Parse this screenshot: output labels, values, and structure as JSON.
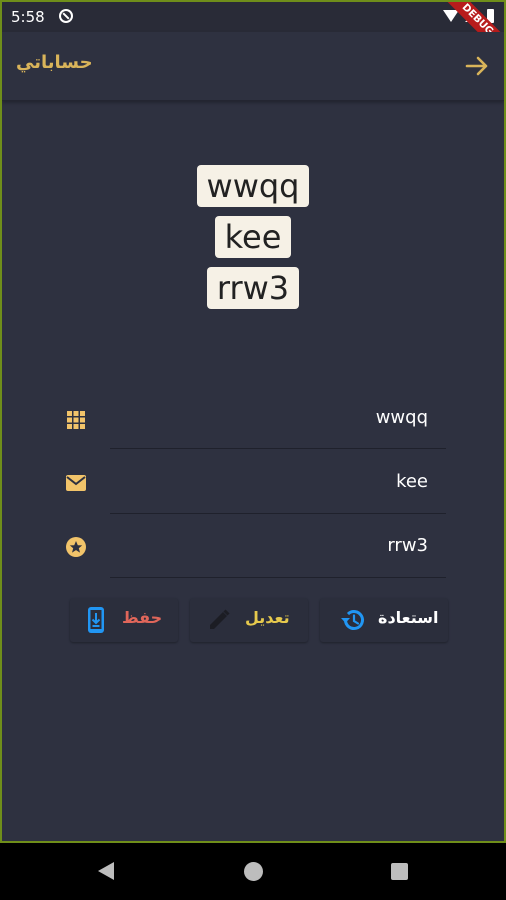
{
  "status_bar": {
    "time": "5:58",
    "debug_label": "DEBUG"
  },
  "app_bar": {
    "title": "حساباتي",
    "forward_icon": "arrow-forward-icon"
  },
  "tags": [
    "wwqq",
    "kee",
    "rrw3"
  ],
  "fields": [
    {
      "icon": "grid-icon",
      "value": "wwqq"
    },
    {
      "icon": "mail-icon",
      "value": "kee"
    },
    {
      "icon": "star-circle-icon",
      "value": "rrw3"
    }
  ],
  "actions": {
    "save": {
      "label": "حفظ",
      "icon": "phone-download-icon",
      "icon_color": "#2196f3",
      "label_color": "#e0665a"
    },
    "edit": {
      "label": "تعديل",
      "icon": "pencil-icon",
      "icon_color": "#1c1d24",
      "label_color": "#e6c94d"
    },
    "restore": {
      "label": "استعادة",
      "icon": "history-icon",
      "icon_color": "#2196f3",
      "label_color": "#ffffff"
    }
  },
  "colors": {
    "background": "#2e3140",
    "accent": "#d9b45a",
    "icon_accent": "#f2c46a"
  }
}
